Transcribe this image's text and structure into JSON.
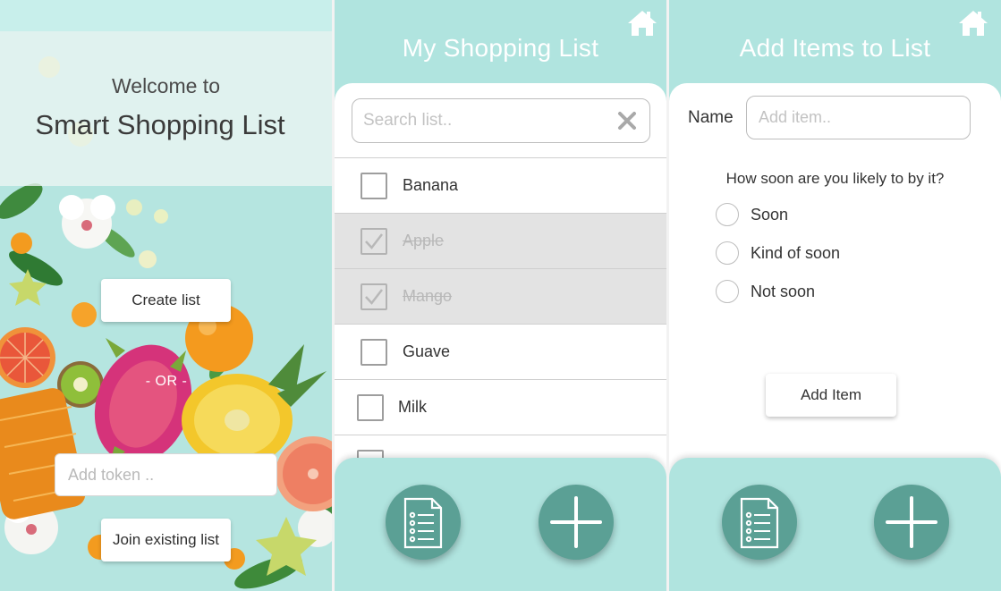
{
  "welcome": {
    "greeting": "Welcome to",
    "app_name": "Smart Shopping List",
    "create_button": "Create list",
    "or_separator": "- OR -",
    "token_placeholder": "Add token ..",
    "join_button": "Join existing list"
  },
  "shopping_list": {
    "title": "My Shopping List",
    "search_placeholder": "Search list..",
    "items": [
      {
        "label": "Banana",
        "checked": false
      },
      {
        "label": "Apple",
        "checked": true
      },
      {
        "label": "Mango",
        "checked": true
      },
      {
        "label": "Guave",
        "checked": false
      },
      {
        "label": "Milk",
        "checked": false
      }
    ]
  },
  "add_items": {
    "title": "Add Items to List",
    "name_label": "Name",
    "name_placeholder": "Add item..",
    "question": "How soon are you likely to by it?",
    "options": [
      "Soon",
      "Kind of soon",
      "Not soon"
    ],
    "add_button": "Add Item"
  },
  "footer": {
    "left_icon": "list-document-icon",
    "right_icon": "plus-icon"
  },
  "colors": {
    "header_teal": "#b0e4df",
    "button_teal": "#5ba095",
    "checked_row": "#e3e3e3"
  }
}
